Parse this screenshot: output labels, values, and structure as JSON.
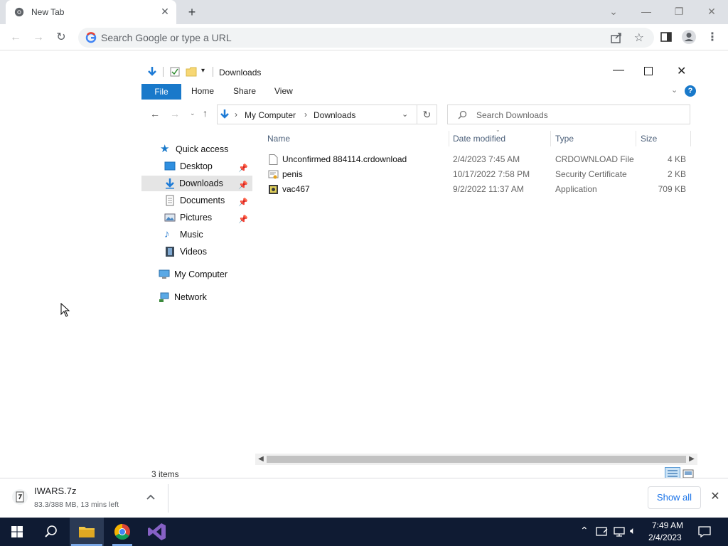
{
  "browser": {
    "tab_title": "New Tab",
    "omnibox_placeholder": "Search Google or type a URL"
  },
  "explorer": {
    "window_title": "Downloads",
    "ribbon_tabs": [
      "File",
      "Home",
      "Share",
      "View"
    ],
    "breadcrumb": [
      "My Computer",
      "Downloads"
    ],
    "search_placeholder": "Search Downloads",
    "nav": {
      "quick_access": "Quick access",
      "desktop": "Desktop",
      "downloads": "Downloads",
      "documents": "Documents",
      "pictures": "Pictures",
      "music": "Music",
      "videos": "Videos",
      "my_computer": "My Computer",
      "network": "Network"
    },
    "columns": {
      "name": "Name",
      "date": "Date modified",
      "type": "Type",
      "size": "Size"
    },
    "files": [
      {
        "name": "Unconfirmed 884114.crdownload",
        "date": "2/4/2023 7:45 AM",
        "type": "CRDOWNLOAD File",
        "size": "4 KB"
      },
      {
        "name": "penis",
        "date": "10/17/2022 7:58 PM",
        "type": "Security Certificate",
        "size": "2 KB"
      },
      {
        "name": "vac467",
        "date": "9/2/2022 11:37 AM",
        "type": "Application",
        "size": "709 KB"
      }
    ],
    "status_items": "3 items"
  },
  "downloads_bar": {
    "filename": "IWARS.7z",
    "status": "83.3/388 MB, 13 mins left",
    "show_all": "Show all"
  },
  "taskbar": {
    "time": "7:49 AM",
    "date": "2/4/2023"
  },
  "colors": {
    "accent": "#1979ca",
    "selected_nav": "#e5e5e5",
    "taskbar": "#0f1b33"
  }
}
